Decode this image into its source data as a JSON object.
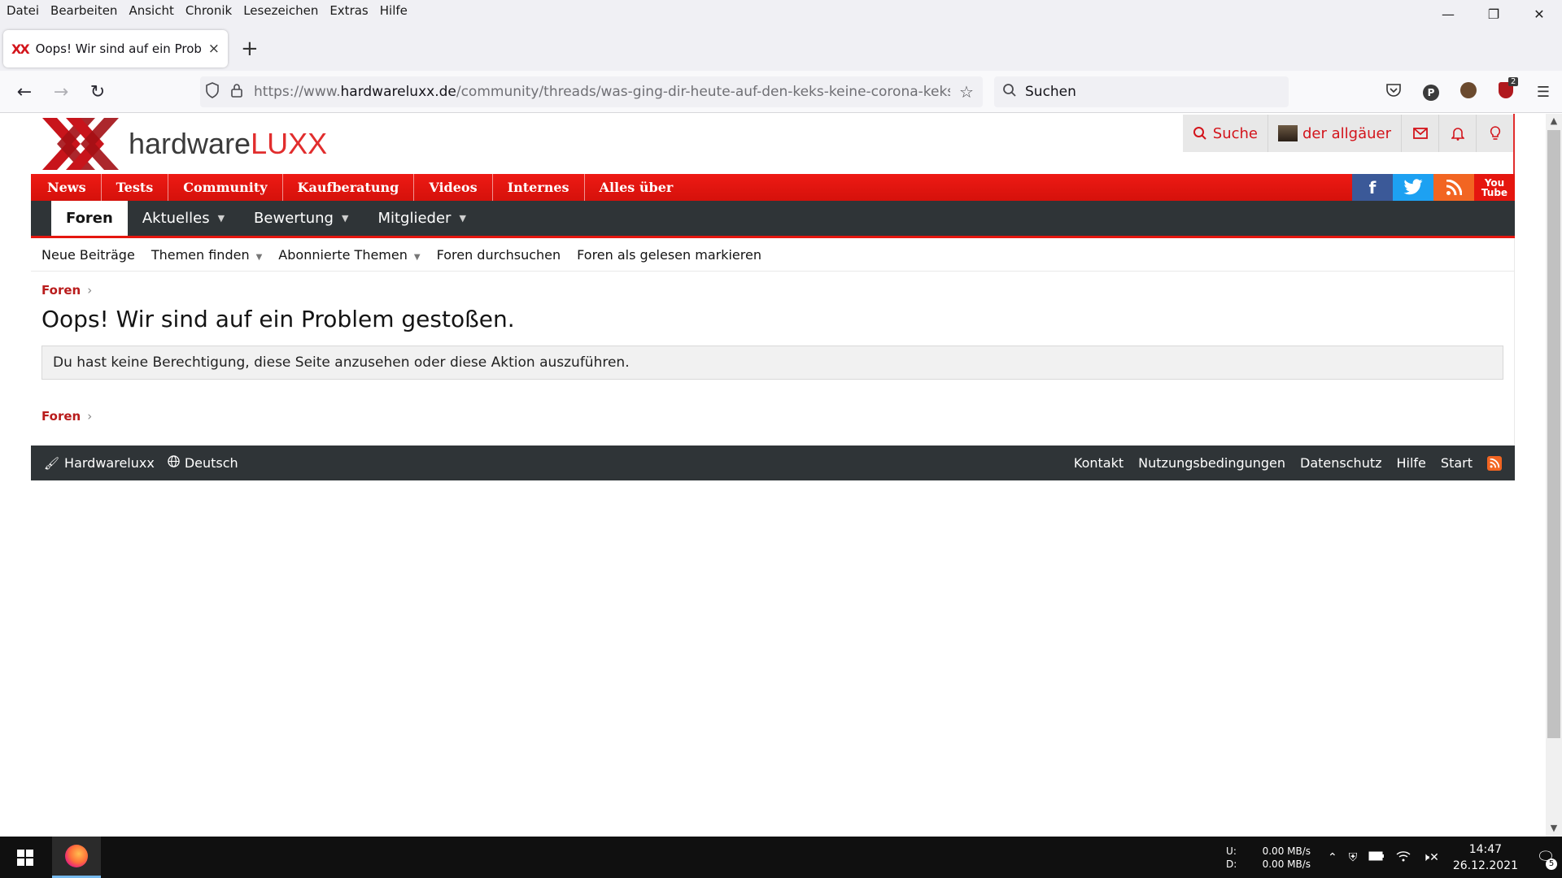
{
  "menubar": {
    "items": [
      "Datei",
      "Bearbeiten",
      "Ansicht",
      "Chronik",
      "Lesezeichen",
      "Extras",
      "Hilfe"
    ]
  },
  "window": {
    "minimize": "—",
    "maximize": "❐",
    "close": "✕"
  },
  "tab": {
    "favicon": "XX",
    "title": "Oops! Wir sind auf ein Problem gestoßen. | Hardwareluxx",
    "close": "×",
    "new_tab": "+"
  },
  "nav": {
    "back": "←",
    "forward": "→",
    "reload": "↻",
    "url_prefix": "https://www.",
    "url_domain": "hardwareluxx.de",
    "url_path": "/community/threads/was-ging-dir-heute-auf-den-keks-keine-corona-kekse-keine",
    "search_placeholder": "Suchen",
    "extension_badge": "2",
    "profile_initial": "P"
  },
  "site": {
    "logo_word_a": "hardware",
    "logo_word_b": "LUXX",
    "header_actions": {
      "search": "Suche",
      "user": "der allgäuer"
    },
    "red_nav": [
      "News",
      "Tests",
      "Community",
      "Kaufberatung",
      "Videos",
      "Internes",
      "Alles über"
    ],
    "social": {
      "facebook": "f",
      "rss": "◉",
      "youtube_a": "You",
      "youtube_b": "Tube"
    },
    "dark_nav": [
      {
        "label": "Foren",
        "active": true
      },
      {
        "label": "Aktuelles"
      },
      {
        "label": "Bewertung"
      },
      {
        "label": "Mitglieder"
      }
    ],
    "sub_nav": [
      "Neue Beiträge",
      "Themen finden",
      "Abonnierte Themen",
      "Foren durchsuchen",
      "Foren als gelesen markieren"
    ],
    "breadcrumb": "Foren",
    "page_title": "Oops! Wir sind auf ein Problem gestoßen.",
    "notice": "Du hast keine Berechtigung, diese Seite anzusehen oder diese Aktion auszuführen.",
    "footer": {
      "brand": "Hardwareluxx",
      "language": "Deutsch",
      "links": [
        "Kontakt",
        "Nutzungsbedingungen",
        "Datenschutz",
        "Hilfe",
        "Start"
      ]
    }
  },
  "taskbar": {
    "upload_label": "U:",
    "download_label": "D:",
    "upload_rate": "0.00 MB/s",
    "download_rate": "0.00 MB/s",
    "time": "14:47",
    "date": "26.12.2021",
    "notification_count": "5"
  },
  "colors": {
    "brand_red": "#e5160f",
    "dark_nav": "#2f3437",
    "crumb_red": "#b91c1c"
  }
}
